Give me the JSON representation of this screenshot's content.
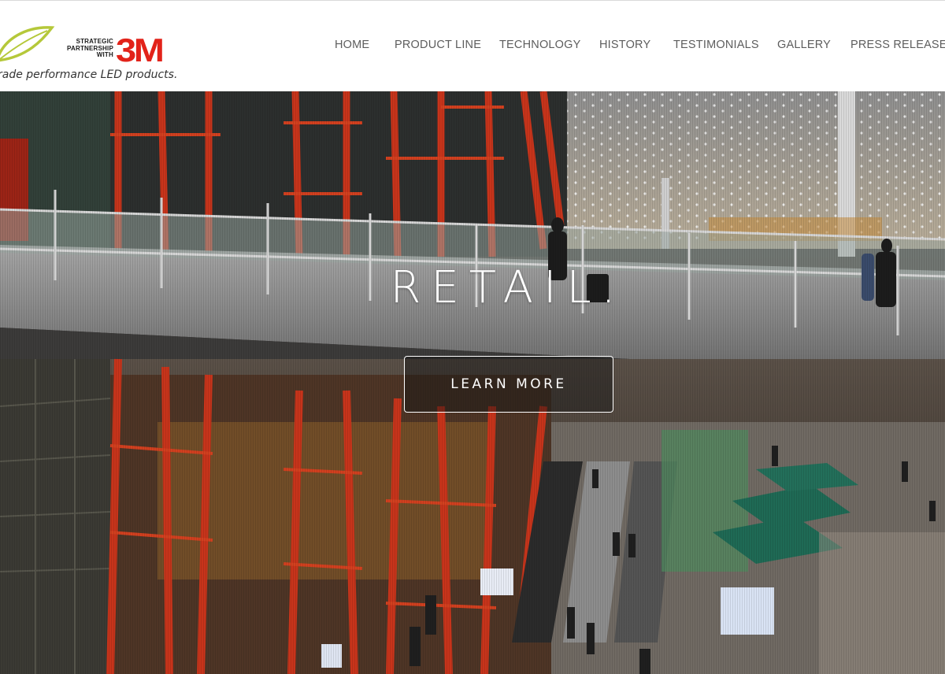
{
  "header": {
    "logo": {
      "partner_lines": [
        "STRATEGIC",
        "PARTNERSHIP",
        "WITH"
      ],
      "brand": "3M",
      "tagline": "rade performance LED products.",
      "brand_color": "#e2231a",
      "leaf_color": "#b5c83a"
    },
    "nav": [
      {
        "label": "HOME"
      },
      {
        "label": "PRODUCT LINE"
      },
      {
        "label": "TECHNOLOGY"
      },
      {
        "label": "HISTORY"
      },
      {
        "label": "TESTIMONIALS"
      },
      {
        "label": "GALLERY"
      },
      {
        "label": "PRESS RELEASES"
      }
    ]
  },
  "hero": {
    "title": "RETAIL.",
    "cta_label": "LEARN MORE"
  }
}
